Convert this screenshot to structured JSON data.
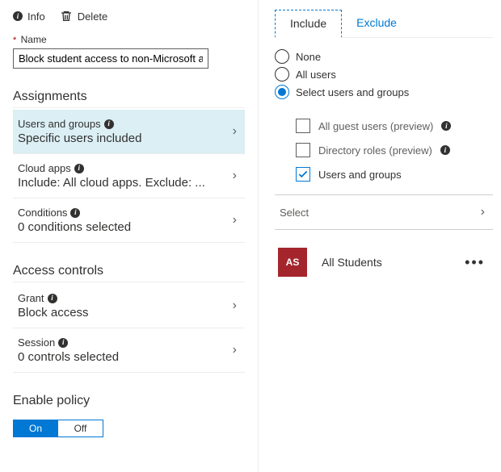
{
  "toolbar": {
    "info": "Info",
    "delete": "Delete"
  },
  "name_field": {
    "label": "Name",
    "value": "Block student access to non-Microsoft apps"
  },
  "sections": {
    "assignments": "Assignments",
    "access_controls": "Access controls",
    "enable_policy": "Enable policy"
  },
  "items": {
    "users_groups": {
      "title": "Users and groups",
      "sub": "Specific users included"
    },
    "cloud_apps": {
      "title": "Cloud apps",
      "sub": "Include: All cloud apps. Exclude: ..."
    },
    "conditions": {
      "title": "Conditions",
      "sub": "0 conditions selected"
    },
    "grant": {
      "title": "Grant",
      "sub": "Block access"
    },
    "session": {
      "title": "Session",
      "sub": "0 controls selected"
    }
  },
  "toggle": {
    "on": "On",
    "off": "Off"
  },
  "tabs": {
    "include": "Include",
    "exclude": "Exclude"
  },
  "radios": {
    "none": "None",
    "all_users": "All users",
    "select_users": "Select users and groups"
  },
  "checks": {
    "guest": "All guest users (preview)",
    "roles": "Directory roles (preview)",
    "ug": "Users and groups"
  },
  "select_label": "Select",
  "entity": {
    "initials": "AS",
    "name": "All Students"
  }
}
